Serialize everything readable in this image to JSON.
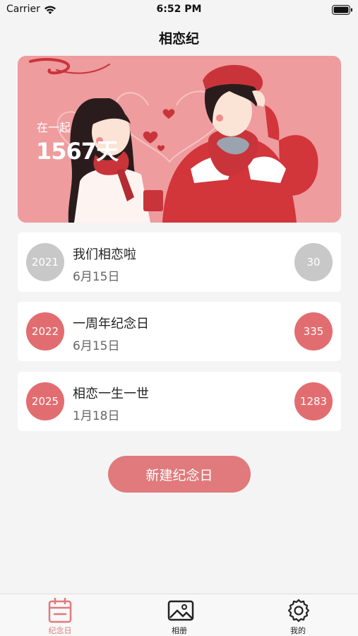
{
  "status_bar": {
    "carrier": "Carrier",
    "time": "6:52 PM"
  },
  "nav": {
    "title": "相恋纪"
  },
  "hero": {
    "together_label": "在一起",
    "together_days": "1567天"
  },
  "anniversaries": [
    {
      "year": "2021",
      "title": "我们相恋啦",
      "date": "6月15日",
      "count": "30",
      "style": "gray"
    },
    {
      "year": "2022",
      "title": "一周年纪念日",
      "date": "6月15日",
      "count": "335",
      "style": "red"
    },
    {
      "year": "2025",
      "title": "相恋一生一世",
      "date": "1月18日",
      "count": "1283",
      "style": "red"
    }
  ],
  "actions": {
    "new_label": "新建纪念日"
  },
  "tab_bar": {
    "tabs": [
      {
        "label": "纪念日",
        "icon": "calendar-icon",
        "active": true
      },
      {
        "label": "相册",
        "icon": "photo-icon",
        "active": false
      },
      {
        "label": "我的",
        "icon": "gear-icon",
        "active": false
      }
    ]
  },
  "colors": {
    "accent": "#e07a7c",
    "hero_bg": "#ee9c9e",
    "past_badge": "#c8c8c8",
    "future_badge": "#e26d70"
  }
}
